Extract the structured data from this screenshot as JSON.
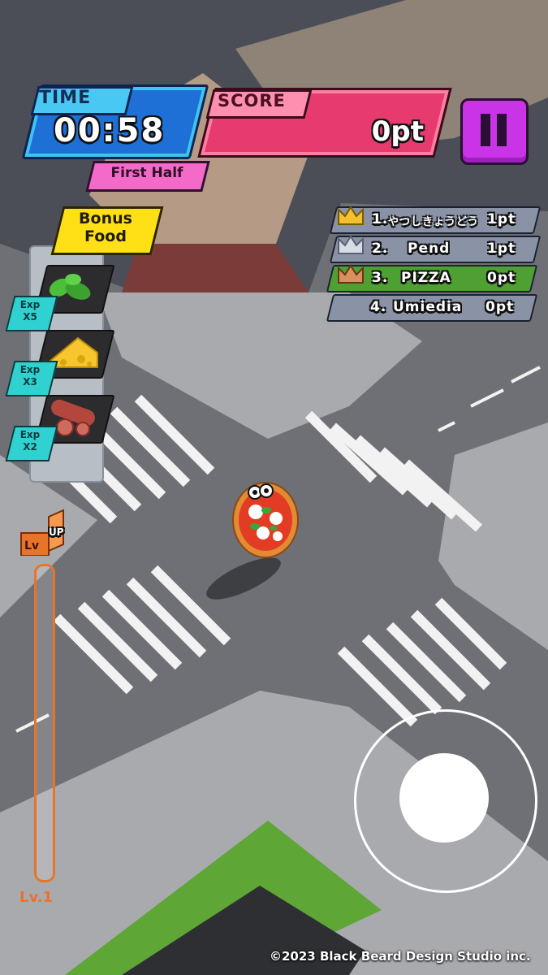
{
  "hud": {
    "time_label": "TIME",
    "time_value": "00:58",
    "half": "First Half",
    "score_label": "SCORE",
    "score_value": "0pt",
    "pause_icon": "pause-icon"
  },
  "bonus": {
    "label": "Bonus Food",
    "items": [
      {
        "icon": "basil-icon",
        "exp": "Exp",
        "mult": "X5"
      },
      {
        "icon": "cheese-icon",
        "exp": "Exp",
        "mult": "X3"
      },
      {
        "icon": "salami-icon",
        "exp": "Exp",
        "mult": "X2"
      }
    ]
  },
  "leaderboard": [
    {
      "rank": "1.",
      "name": "やつしきょうどう",
      "points": "1pt",
      "crown": "gold",
      "highlight": false
    },
    {
      "rank": "2.",
      "name": "Pend",
      "points": "1pt",
      "crown": "silver",
      "highlight": false
    },
    {
      "rank": "3.",
      "name": "PIZZA",
      "points": "0pt",
      "crown": "bronze",
      "highlight": true
    },
    {
      "rank": "4.",
      "name": "Umiedia",
      "points": "0pt",
      "crown": "none",
      "highlight": false
    }
  ],
  "level": {
    "up_label": "UP",
    "lv_label": "Lv",
    "current": "Lv.1",
    "progress": 0
  },
  "copyright": "©2023 Black Beard Design Studio inc.",
  "colors": {
    "time": "#1e6fd6",
    "score": "#e73b70",
    "pause": "#c935e6",
    "bonus": "#ffe017",
    "exp": "#2fd1d1",
    "player_row": "#4ea033",
    "gauge": "#e8742a"
  }
}
